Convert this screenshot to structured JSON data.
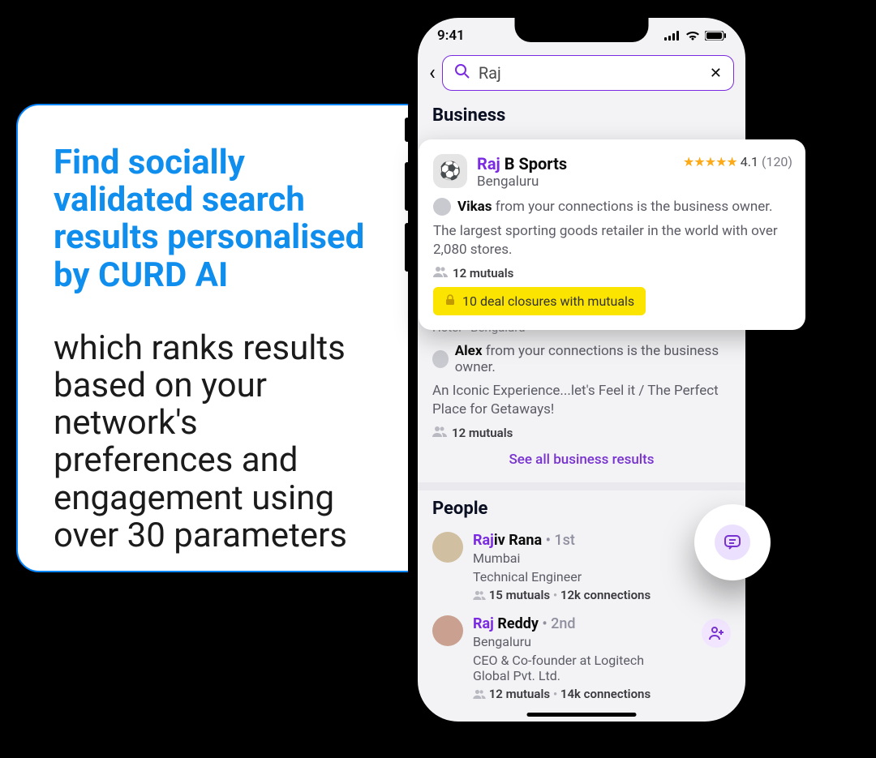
{
  "promo": {
    "headline": "Find socially validated search results personalised by CURD AI",
    "sub": "which ranks results based on your network's preferences and engagement using over 30 parameters"
  },
  "status": {
    "time": "9:41"
  },
  "search": {
    "back_label": "‹",
    "query": "Raj",
    "clear_label": "✕"
  },
  "sections": {
    "business": "Business",
    "people": "People",
    "see_all_business": "See all business results"
  },
  "business1": {
    "name_hl": "Raj",
    "name_rest": " B Sports",
    "location": "Bengaluru",
    "ratingValue": "4.1",
    "ratingCount": "(120)",
    "owner_name": "Vikas",
    "owner_rest": " from your connections is the business owner.",
    "desc": "The largest sporting goods retailer in the world with over 2,080 stores.",
    "mutuals": "12 mutuals",
    "deals": "10 deal closures with mutuals"
  },
  "business2": {
    "top_meta": "Hotel · Bengaluru",
    "owner_name": "Alex",
    "owner_rest": " from your connections is the business owner.",
    "desc": "An Iconic Experience...let's Feel it / The Perfect Place for Getaways!",
    "mutuals": "12 mutuals"
  },
  "people1": {
    "name_hl": "Raj",
    "name_rest": "iv Rana",
    "degree": " • 1st",
    "location": "Mumbai",
    "role": "Technical Engineer",
    "mutuals": "15 mutuals",
    "conns": "12k connections"
  },
  "people2": {
    "name_hl": "Raj",
    "name_rest": " Reddy",
    "degree": " • 2nd",
    "location": "Bengaluru",
    "role": "CEO & Co-founder at Logitech Global Pvt. Ltd.",
    "mutuals": "12 mutuals",
    "conns": "14k connections"
  }
}
